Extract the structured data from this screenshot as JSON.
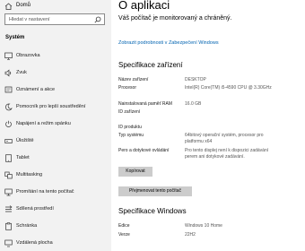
{
  "sidebar": {
    "home_label": "Domů",
    "search_placeholder": "Hledat v nastavení",
    "section_heading": "Systém",
    "items": [
      {
        "label": "Obrazovka",
        "icon": "monitor-icon"
      },
      {
        "label": "Zvuk",
        "icon": "speaker-icon"
      },
      {
        "label": "Oznámení a akce",
        "icon": "notification-icon"
      },
      {
        "label": "Pomocník pro lepší soustředění",
        "icon": "moon-icon"
      },
      {
        "label": "Napájení a režim spánku",
        "icon": "power-icon"
      },
      {
        "label": "Úložiště",
        "icon": "storage-icon"
      },
      {
        "label": "Tablet",
        "icon": "tablet-icon"
      },
      {
        "label": "Multitasking",
        "icon": "multitasking-icon"
      },
      {
        "label": "Promítání na tento počítač",
        "icon": "projector-icon"
      },
      {
        "label": "Sdílená prostředí",
        "icon": "shared-experience-icon"
      },
      {
        "label": "Schránka",
        "icon": "clipboard-icon"
      },
      {
        "label": "Vzdálená plocha",
        "icon": "remote-desktop-icon"
      }
    ]
  },
  "main": {
    "title": "O aplikaci",
    "protection_status": "Váš počítač je monitorovaný a chráněný.",
    "security_link": "Zobrazit podrobnosti v Zabezpečení Windows",
    "device_specs": {
      "heading": "Specifikace zařízení",
      "rows": [
        {
          "label": "Název zařízení",
          "value": "DESKTOP"
        },
        {
          "label": "Procesor",
          "value": "Intel(R) Core(TM) i5-4590 CPU @ 3.30GHz"
        },
        {
          "label": "Nainstalovaná paměť RAM",
          "value": "16.0 GB"
        },
        {
          "label": "ID zařízení",
          "value": ""
        },
        {
          "label": "ID produktu",
          "value": ""
        },
        {
          "label": "Typ systému",
          "value": "64bitový operační systém, procesor pro platformu x64"
        },
        {
          "label": "Pero a dotykové ovládání",
          "value": "Pro tento displej není k dispozici zadávání perem ani dotykové zadávání."
        }
      ],
      "copy_button": "Kopírovat",
      "rename_button": "Přejmenovat tento počítač"
    },
    "windows_specs": {
      "heading": "Specifikace Windows",
      "rows": [
        {
          "label": "Edice",
          "value": "Windows 10 Home"
        },
        {
          "label": "Verze",
          "value": "22H2"
        }
      ]
    }
  },
  "colors": {
    "sidebar_bg": "#f2f2f2",
    "link": "#0063b1",
    "button_bg": "#cccccc"
  }
}
